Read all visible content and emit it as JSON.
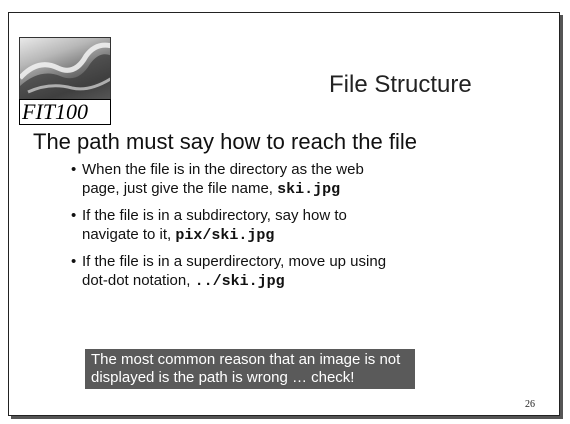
{
  "logo": {
    "label": "FIT100"
  },
  "slide": {
    "title": "File Structure",
    "heading": "The path must say how to reach the file",
    "bullets": [
      {
        "text": "When the file is in the directory as the web page, just give the file name, ",
        "code": "ski.jpg"
      },
      {
        "text": "If the file is in a subdirectory, say how to navigate to it, ",
        "code": "pix/ski.jpg"
      },
      {
        "text": "If the file is in a superdirectory, move up using dot-dot notation, ",
        "code": "../ski.jpg"
      }
    ],
    "bullet_symbol": "•",
    "note": "The most common reason that an image is not displayed is the path is wrong … check!",
    "page_number": "26"
  }
}
